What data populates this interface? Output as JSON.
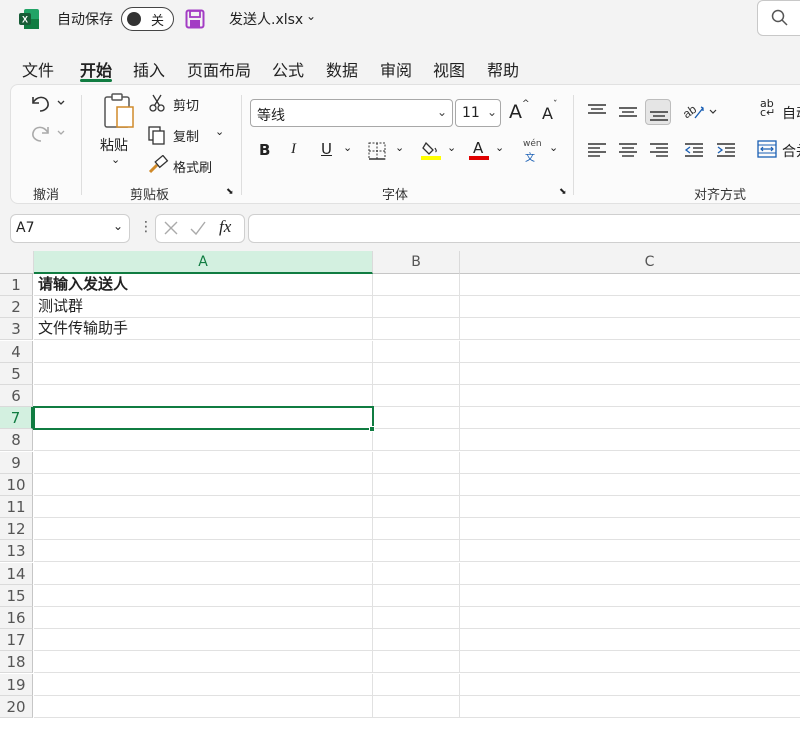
{
  "titlebar": {
    "autosave_label": "自动保存",
    "autosave_state": "关",
    "filename": "发送人.xlsx",
    "accent": "#107c41"
  },
  "tabs": [
    "文件",
    "开始",
    "插入",
    "页面布局",
    "公式",
    "数据",
    "审阅",
    "视图",
    "帮助"
  ],
  "active_tab": "开始",
  "ribbon": {
    "undo_group": "撤消",
    "clipboard": {
      "paste": "粘贴",
      "cut": "剪切",
      "copy": "复制",
      "format_painter": "格式刷",
      "label": "剪贴板"
    },
    "font": {
      "name": "等线",
      "size": "11",
      "grow": "A",
      "shrink": "A",
      "bold": "B",
      "italic": "I",
      "underline": "U",
      "font_color": "A",
      "phonetic_top": "wén",
      "phonetic_bottom": "文",
      "label": "字体",
      "fill_color": "#ffff00",
      "text_color": "#e00000"
    },
    "alignment": {
      "label": "对齐方式",
      "wrap_text": "自动",
      "merge": "合并"
    }
  },
  "formula_bar": {
    "namebox": "A7",
    "fx": "fx",
    "content": ""
  },
  "grid": {
    "columns": [
      "A",
      "B",
      "C"
    ],
    "selected_column": "A",
    "rows": [
      {
        "num": "1",
        "a": "请输入发送人",
        "bold": true
      },
      {
        "num": "2",
        "a": "测试群"
      },
      {
        "num": "3",
        "a": "文件传输助手"
      },
      {
        "num": "4",
        "a": ""
      },
      {
        "num": "5",
        "a": ""
      },
      {
        "num": "6",
        "a": ""
      },
      {
        "num": "7",
        "a": ""
      },
      {
        "num": "8",
        "a": ""
      },
      {
        "num": "9",
        "a": ""
      },
      {
        "num": "10",
        "a": ""
      },
      {
        "num": "11",
        "a": ""
      },
      {
        "num": "12",
        "a": ""
      },
      {
        "num": "13",
        "a": ""
      },
      {
        "num": "14",
        "a": ""
      },
      {
        "num": "15",
        "a": ""
      },
      {
        "num": "16",
        "a": ""
      },
      {
        "num": "17",
        "a": ""
      },
      {
        "num": "18",
        "a": ""
      },
      {
        "num": "19",
        "a": ""
      },
      {
        "num": "20",
        "a": ""
      }
    ],
    "selected_row": "7"
  }
}
